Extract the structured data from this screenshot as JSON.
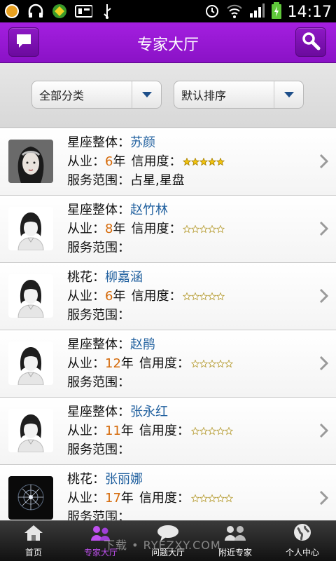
{
  "status_bar": {
    "time": "14:17"
  },
  "header": {
    "title": "专家大厅"
  },
  "filters": {
    "category": "全部分类",
    "sort": "默认排序"
  },
  "experts": [
    {
      "category": "星座整体：",
      "name": "苏颜",
      "years_label": "从业：",
      "years": "6",
      "year_unit": "年",
      "credit_label": "信用度：",
      "service_label": "服务范围：",
      "service": "占星,星盘",
      "avatar": "photo",
      "stars": "gold"
    },
    {
      "category": "星座整体：",
      "name": "赵竹林",
      "years_label": "从业：",
      "years": "8",
      "year_unit": "年",
      "credit_label": "信用度：",
      "service_label": "服务范围：",
      "service": "",
      "avatar": "default",
      "stars": "gray"
    },
    {
      "category": "桃花：",
      "name": "柳嘉涵",
      "years_label": "从业：",
      "years": "6",
      "year_unit": "年",
      "credit_label": "信用度：",
      "service_label": "服务范围：",
      "service": "",
      "avatar": "default",
      "stars": "gray"
    },
    {
      "category": "星座整体：",
      "name": "赵鹃",
      "years_label": "从业：",
      "years": "12",
      "year_unit": "年",
      "credit_label": "信用度：",
      "service_label": "服务范围：",
      "service": "",
      "avatar": "default",
      "stars": "gray"
    },
    {
      "category": "星座整体：",
      "name": "张永红",
      "years_label": "从业：",
      "years": "11",
      "year_unit": "年",
      "credit_label": "信用度：",
      "service_label": "服务范围：",
      "service": "",
      "avatar": "default",
      "stars": "gray"
    },
    {
      "category": "桃花：",
      "name": "张丽娜",
      "years_label": "从业：",
      "years": "17",
      "year_unit": "年",
      "credit_label": "信用度：",
      "service_label": "服务范围：",
      "service": "",
      "avatar": "dark",
      "stars": "gray"
    }
  ],
  "tabs": [
    {
      "label": "首页",
      "icon": "home-icon"
    },
    {
      "label": "专家大厅",
      "icon": "experts-icon",
      "active": true
    },
    {
      "label": "问题大厅",
      "icon": "chat-icon"
    },
    {
      "label": "附近专家",
      "icon": "nearby-icon"
    },
    {
      "label": "个人中心",
      "icon": "globe-icon"
    }
  ],
  "watermark": "下载 • RYEZXY.COM",
  "colors": {
    "header": "#9a18d8",
    "name": "#1f5f9e",
    "years": "#d56a0a",
    "active_tab": "#c050f0"
  }
}
